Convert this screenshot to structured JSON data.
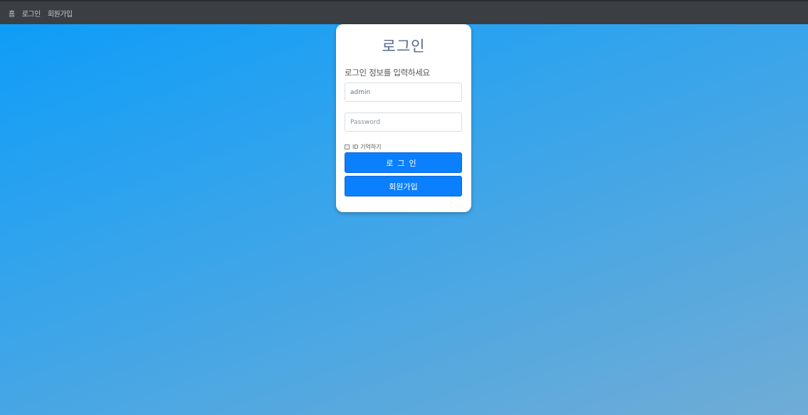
{
  "nav": {
    "items": [
      "홈",
      "로그인",
      "회원가입"
    ]
  },
  "login_card": {
    "title": "로그인",
    "subtitle": "로그인 정보를 입력하세요",
    "username_value": "admin",
    "password_placeholder": "Password",
    "remember_label": "ID 기억하기",
    "login_button": "로그인",
    "signup_button": "회원가입"
  },
  "colors": {
    "topbar": "#3b3e43",
    "button": "#0a80ff",
    "title": "#556b8a",
    "background_start": "#0b9cf8",
    "background_end": "#70acd6"
  }
}
